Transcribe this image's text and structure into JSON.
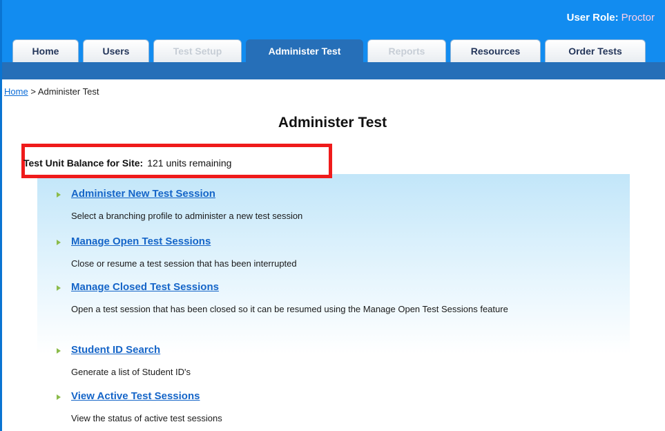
{
  "header": {
    "role_label": "User Role:",
    "role_value": "Proctor"
  },
  "tabs": [
    {
      "label": "Home",
      "state": "normal"
    },
    {
      "label": "Users",
      "state": "normal"
    },
    {
      "label": "Test Setup",
      "state": "disabled"
    },
    {
      "label": "Administer Test",
      "state": "active"
    },
    {
      "label": "Reports",
      "state": "disabled"
    },
    {
      "label": "Resources",
      "state": "normal"
    },
    {
      "label": "Order Tests",
      "state": "normal"
    }
  ],
  "breadcrumb": {
    "home": "Home",
    "separator": ">",
    "current": "Administer Test"
  },
  "page_title": "Administer Test",
  "balance": {
    "label": "Test Unit Balance for Site:",
    "value": "121 units remaining"
  },
  "items": [
    {
      "title": "Administer New Test Session",
      "description": "Select a branching profile to administer a new test session"
    },
    {
      "title": "Manage Open Test Sessions",
      "description": "Close or resume a test session that has been interrupted"
    },
    {
      "title": "Manage Closed Test Sessions",
      "description": "Open a test session that has been closed so it can be resumed using the Manage Open Test Sessions feature"
    },
    {
      "title": "Student ID Search",
      "description": "Generate a list of Student ID's"
    },
    {
      "title": "View Active Test Sessions",
      "description": "View the status of active test sessions"
    }
  ],
  "colors": {
    "header_blue": "#128cf0",
    "nav_blue": "#266fb8",
    "link_blue": "#1565c8",
    "highlight_red": "#ef1b1b",
    "arrow_green": "#8bbb4a"
  }
}
